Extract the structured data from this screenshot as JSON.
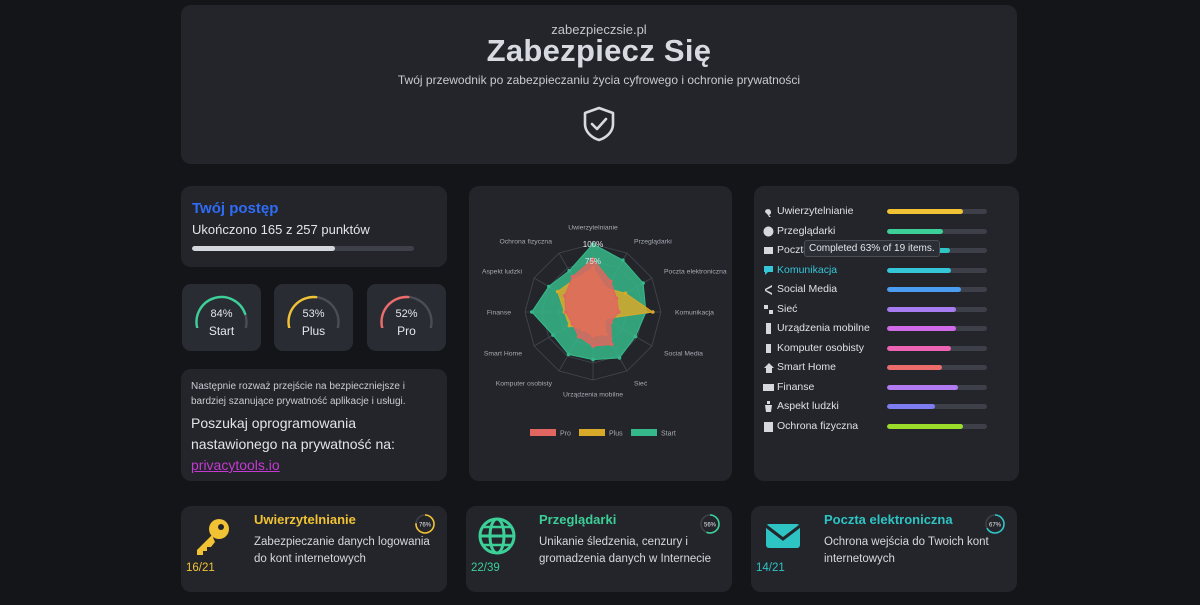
{
  "header": {
    "domain": "zabezpieczsie.pl",
    "title": "Zabezpiecz Się",
    "tagline": "Twój przewodnik po zabezpieczaniu życia cyfrowego i ochronie prywatności",
    "icon": "shield-check-icon"
  },
  "progress": {
    "title": "Twój postęp",
    "subtitle": "Ukończono 165 z 257 punktów",
    "completed": 165,
    "total": 257
  },
  "gauges": [
    {
      "name": "start",
      "percent_label": "84%",
      "label": "Start",
      "value": 84,
      "color": "#3ccf98"
    },
    {
      "name": "plus",
      "percent_label": "53%",
      "label": "Plus",
      "value": 53,
      "color": "#f1c233"
    },
    {
      "name": "pro",
      "percent_label": "52%",
      "label": "Pro",
      "value": 52,
      "color": "#ec6c6c"
    }
  ],
  "info": {
    "note": "Następnie rozważ przejście na bezpieczniejsze i bardziej szanujące prywatność aplikacje i usługi.",
    "prompt": "Poszukaj oprogramowania nastawionego na prywatność na:",
    "link_text": "privacytools.io"
  },
  "radar": {
    "axes": [
      "Uwierzytelnianie",
      "Przeglądarki",
      "Poczta elektroniczna",
      "Komunikacja",
      "Social Media",
      "Sieć",
      "Urządzenia mobilne",
      "Komputer osobisty",
      "Smart Home",
      "Finanse",
      "Aspekt ludzki",
      "Ochrona fizyczna"
    ],
    "ticks": [
      "100%",
      "75%"
    ],
    "series": [
      {
        "name": "Pro",
        "color": "#e0665f",
        "values": [
          78,
          52,
          40,
          38,
          30,
          55,
          50,
          42,
          35,
          40,
          48,
          60
        ]
      },
      {
        "name": "Plus",
        "color": "#d9a92a",
        "values": [
          65,
          40,
          55,
          88,
          20,
          38,
          35,
          30,
          40,
          42,
          60,
          55
        ]
      },
      {
        "name": "Start",
        "color": "#36b98a",
        "values": [
          100,
          88,
          85,
          78,
          72,
          78,
          70,
          72,
          68,
          90,
          75,
          70
        ]
      }
    ],
    "legend": [
      "Pro",
      "Plus",
      "Start"
    ]
  },
  "categories": [
    {
      "label": "Uwierzytelnianie",
      "icon": "key-icon",
      "percent": 76,
      "color": "#f1c233",
      "active": false
    },
    {
      "label": "Przeglądarki",
      "icon": "globe-icon",
      "percent": 56,
      "color": "#3ccf98",
      "active": false
    },
    {
      "label": "Poczta elektroniczna",
      "icon": "envelope-icon",
      "percent": 63,
      "color": "#2ec4c4",
      "active": false
    },
    {
      "label": "Komunikacja",
      "icon": "chat-icon",
      "percent": 64,
      "color": "#35c6d8",
      "active": true
    },
    {
      "label": "Social Media",
      "icon": "share-icon",
      "percent": 74,
      "color": "#4a9df1",
      "active": false
    },
    {
      "label": "Sieć",
      "icon": "network-icon",
      "percent": 69,
      "color": "#a77cf0",
      "active": false
    },
    {
      "label": "Urządzenia mobilne",
      "icon": "phone-icon",
      "percent": 69,
      "color": "#d06ae8",
      "active": false
    },
    {
      "label": "Komputer osobisty",
      "icon": "mouse-icon",
      "percent": 64,
      "color": "#ec64b2",
      "active": false
    },
    {
      "label": "Smart Home",
      "icon": "smart-home-icon",
      "percent": 55,
      "color": "#ec6c6c",
      "active": false
    },
    {
      "label": "Finanse",
      "icon": "card-icon",
      "percent": 71,
      "color": "#b27af0",
      "active": false
    },
    {
      "label": "Aspekt ludzki",
      "icon": "person-icon",
      "percent": 48,
      "color": "#7d7cf0",
      "active": false
    },
    {
      "label": "Ochrona fizyczna",
      "icon": "building-icon",
      "percent": 76,
      "color": "#9bdc2a",
      "active": false
    }
  ],
  "tooltip": "Completed 63% of 19 items.",
  "cards": [
    {
      "title": "Uwierzytelnianie",
      "description": "Zabezpieczanie danych logowania do kont internetowych",
      "count": "16/21",
      "ring_label": "76%",
      "ring_value": 76,
      "color": "#f1c233",
      "icon": "key-icon"
    },
    {
      "title": "Przeglądarki",
      "description": "Unikanie śledzenia, cenzury i gromadzenia danych w Internecie",
      "count": "22/39",
      "ring_label": "56%",
      "ring_value": 56,
      "color": "#3ccf98",
      "icon": "globe-icon"
    },
    {
      "title": "Poczta elektroniczna",
      "description": "Ochrona wejścia do Twoich kont internetowych",
      "count": "14/21",
      "ring_label": "67%",
      "ring_value": 67,
      "color": "#2ec4c4",
      "icon": "envelope-icon"
    }
  ]
}
